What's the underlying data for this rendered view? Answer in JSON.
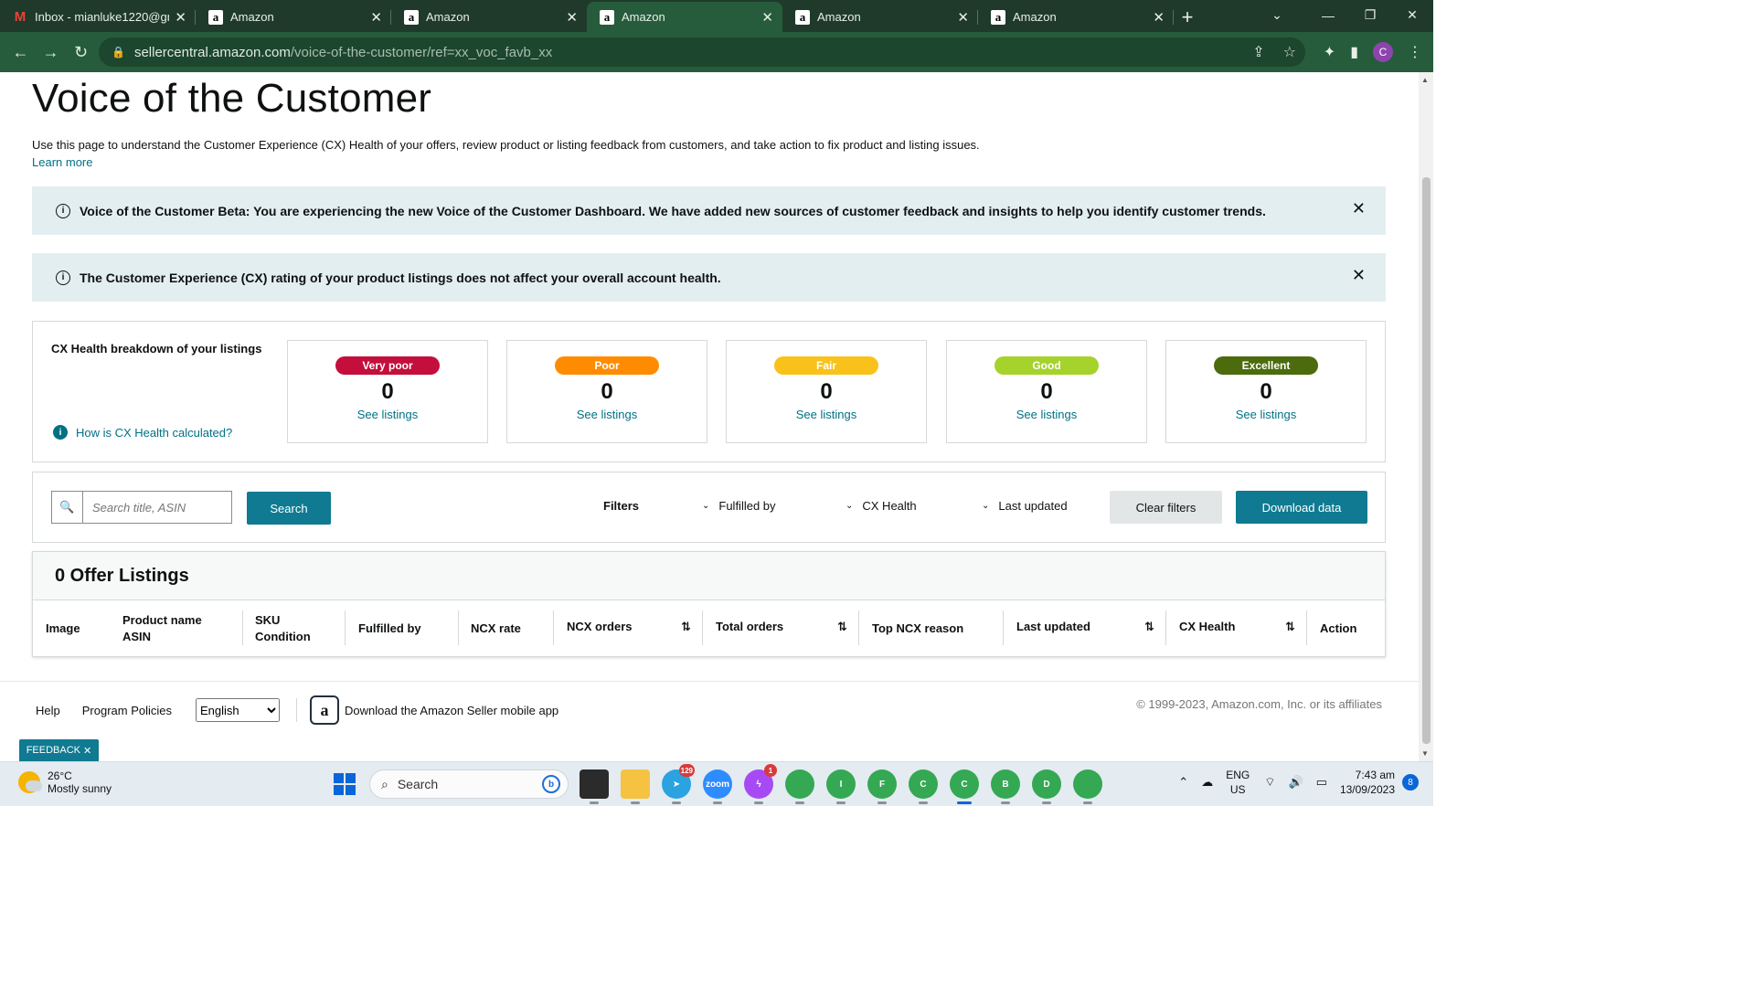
{
  "browser": {
    "tabs": [
      {
        "label": "Inbox - mianluke1220@gm",
        "icon": "gmail-icon"
      },
      {
        "label": "Amazon",
        "icon": "amazon-icon"
      },
      {
        "label": "Amazon",
        "icon": "amazon-icon"
      },
      {
        "label": "Amazon",
        "icon": "amazon-icon",
        "active": true
      },
      {
        "label": "Amazon",
        "icon": "amazon-icon"
      },
      {
        "label": "Amazon",
        "icon": "amazon-icon"
      }
    ],
    "url_host": "sellercentral.amazon.com",
    "url_path": "/voice-of-the-customer/ref=xx_voc_favb_xx",
    "profile_initial": "C",
    "theme_color": "#265c3b"
  },
  "page": {
    "title": "Voice of the Customer",
    "intro": "Use this page to understand the Customer Experience (CX) Health of your offers, review product or listing feedback from customers, and take action to fix product and listing issues.",
    "learn_more": "Learn more",
    "banner_beta": "Voice of the Customer Beta: You are experiencing the new Voice of the Customer Dashboard. We have added new sources of customer feedback and insights to help you identify customer trends.",
    "banner_rating": "The Customer Experience (CX) rating of your product listings does not affect your overall account health.",
    "cx": {
      "label": "CX Health breakdown of your listings",
      "how_link": "How is CX Health calculated?",
      "cards": [
        {
          "label": "Very poor",
          "count": "0",
          "link": "See listings",
          "color": "#c40e3c"
        },
        {
          "label": "Poor",
          "count": "0",
          "link": "See listings",
          "color": "#ff8c00"
        },
        {
          "label": "Fair",
          "count": "0",
          "link": "See listings",
          "color": "#f8c21a"
        },
        {
          "label": "Good",
          "count": "0",
          "link": "See listings",
          "color": "#a5d22b"
        },
        {
          "label": "Excellent",
          "count": "0",
          "link": "See listings",
          "color": "#4b6b0d"
        }
      ]
    },
    "filters": {
      "search_placeholder": "Search title, ASIN",
      "search_button": "Search",
      "label": "Filters",
      "fulfilled_by": "Fulfilled by",
      "cx_health": "CX Health",
      "last_updated": "Last updated",
      "clear_button": "Clear filters",
      "download_button": "Download data"
    },
    "listings": {
      "heading": "0 Offer Listings",
      "columns": {
        "image": "Image",
        "product_name": "Product name",
        "asin": "ASIN",
        "sku": "SKU",
        "condition": "Condition",
        "fulfilled_by": "Fulfilled by",
        "ncx_rate": "NCX rate",
        "ncx_orders": "NCX orders",
        "total_orders": "Total orders",
        "top_ncx_reason": "Top NCX reason",
        "last_updated": "Last updated",
        "cx_health": "CX Health",
        "action": "Action"
      }
    },
    "footer": {
      "help": "Help",
      "program_policies": "Program Policies",
      "language": "English",
      "app_link": "Download the Amazon Seller mobile app",
      "copyright": "© 1999-2023, Amazon.com, Inc. or its affiliates",
      "feedback": "FEEDBACK"
    }
  },
  "taskbar": {
    "temperature": "26°C",
    "weather": "Mostly sunny",
    "search": "Search",
    "lang_top": "ENG",
    "lang_bottom": "US",
    "time": "7:43 am",
    "date": "13/09/2023",
    "notifications": "8",
    "badges": {
      "telegram": "129",
      "messenger": "1"
    }
  }
}
